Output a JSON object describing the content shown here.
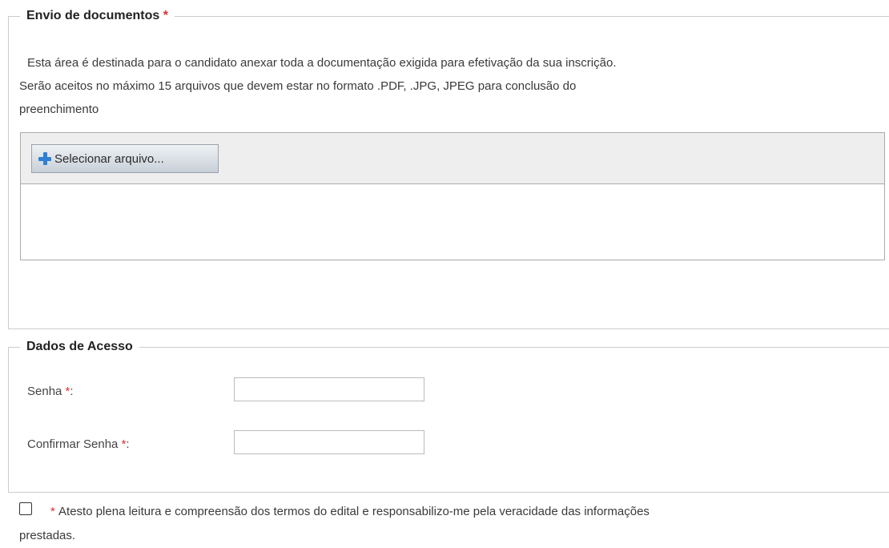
{
  "documents": {
    "legend": "Envio de documentos",
    "required_mark": "*",
    "description_line1": "Esta área é destinada para o candidato anexar toda a documentação exigida para efetivação da sua inscrição.",
    "description_line2": "Serão aceitos no máximo 15 arquivos que devem estar no formato .PDF, .JPG, JPEG para conclusão do",
    "description_line3": "preenchimento",
    "select_button_label": "Selecionar arquivo...",
    "select_button_icon": "plus-icon"
  },
  "access": {
    "legend": "Dados de Acesso",
    "password_label": "Senha ",
    "confirm_label": "Confirmar Senha ",
    "required_mark": "*",
    "label_suffix": ":",
    "password_value": "",
    "confirm_value": ""
  },
  "consent": {
    "required_mark": "*",
    "text_line1": "Atesto plena leitura e compreensão dos termos do edital e responsabilizo-me pela veracidade das informações",
    "text_line2": "prestadas."
  },
  "colors": {
    "required": "#e03030",
    "border": "#cccccc",
    "upload_bar": "#eeeeee",
    "plus_icon": "#2f7fd6"
  }
}
